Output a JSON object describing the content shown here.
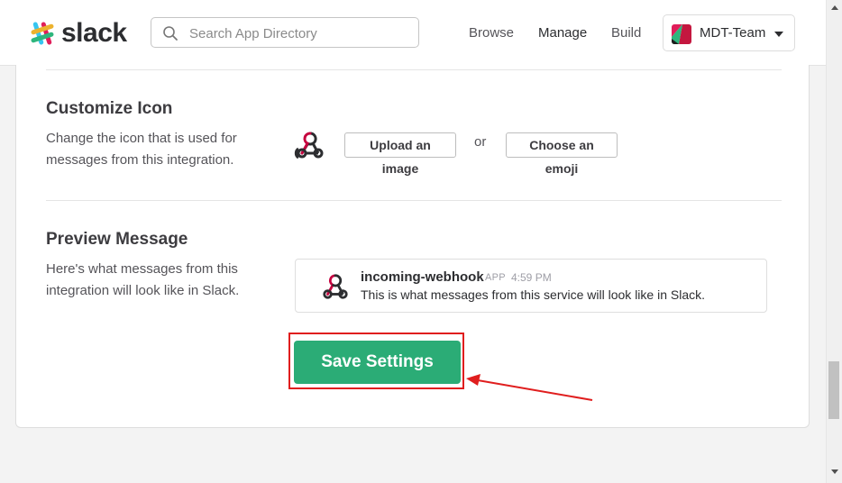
{
  "header": {
    "logo_text": "slack",
    "search_placeholder": "Search App Directory",
    "nav": [
      "Browse",
      "Manage",
      "Build"
    ],
    "active_nav": "Manage",
    "team_name": "MDT-Team"
  },
  "customize_icon": {
    "title": "Customize Icon",
    "description": "Change the icon that is used for messages from this integration.",
    "upload_label": "Upload an image",
    "or_label": "or",
    "emoji_label": "Choose an emoji"
  },
  "preview_message": {
    "title": "Preview Message",
    "description": "Here's what messages from this integration will look like in Slack.",
    "sender": "incoming-webhook",
    "badge": "APP",
    "time": "4:59 PM",
    "text": "This is what messages from this service will look like in Slack."
  },
  "save_label": "Save Settings",
  "colors": {
    "save_green": "#2bac76",
    "highlight_red": "#e01e1e"
  }
}
